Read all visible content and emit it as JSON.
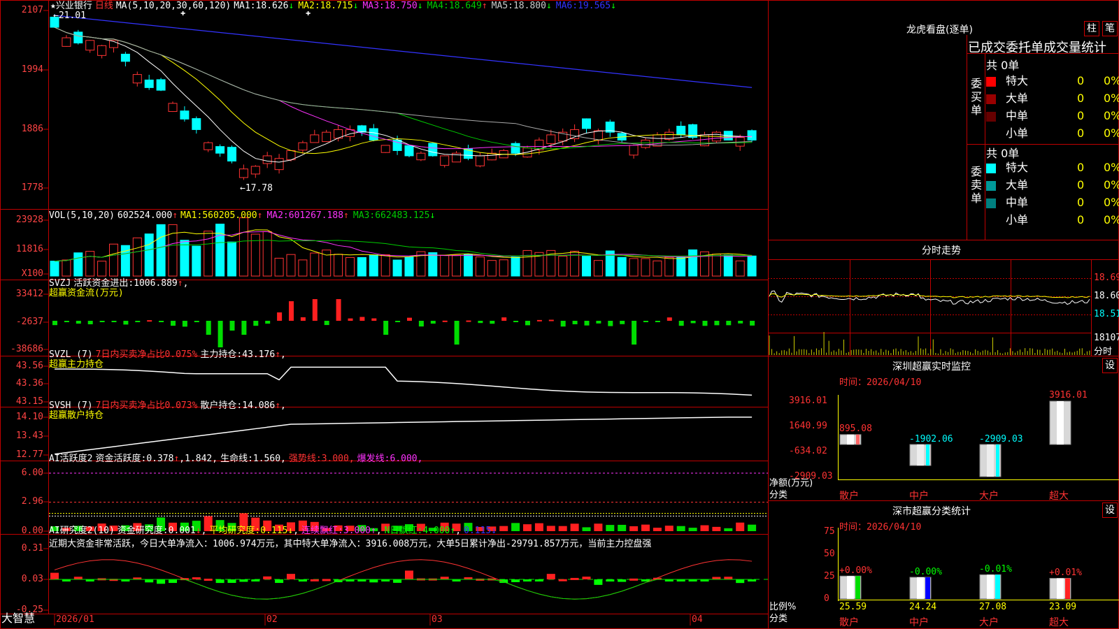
{
  "colors": {
    "up": "#ff3333",
    "down": "#00ffff",
    "grid": "#c00000",
    "ma1": "#ffffff",
    "ma2": "#ffff00",
    "ma3": "#ff33ff",
    "ma4": "#00cc00",
    "ma5": "#aaaaaa",
    "ma6": "#3333ff"
  },
  "stock": {
    "name": "兴业银行",
    "period": "日线",
    "star": "★"
  },
  "main_header": {
    "ma_def": "MA(5,10,20,30,60,120)",
    "ma": [
      {
        "label": "MA1:",
        "value": "18.626",
        "arrow": "↓",
        "color": "#ffffff"
      },
      {
        "label": "MA2:",
        "value": "18.715",
        "arrow": "↓",
        "color": "#ffff00"
      },
      {
        "label": "MA3:",
        "value": "18.750",
        "arrow": "↓",
        "color": "#ff33ff"
      },
      {
        "label": "MA4:",
        "value": "18.649",
        "arrow": "↑",
        "color": "#00cc00"
      },
      {
        "label": "MA5:",
        "value": "18.800",
        "arrow": "↓",
        "color": "#cccccc"
      },
      {
        "label": "MA6:",
        "value": "19.565",
        "arrow": "↓",
        "color": "#3333ff"
      }
    ],
    "high_note": "←21.01",
    "low_note": "←17.78"
  },
  "y_labels": {
    "price": [
      "2107",
      "1994",
      "1886",
      "1778"
    ],
    "vol": [
      "23928",
      "11816",
      "X100"
    ],
    "svzj": [
      "33412",
      "-2637",
      "-38686"
    ],
    "svzl": [
      "43.56",
      "43.36",
      "43.15"
    ],
    "svsh": [
      "14.10",
      "13.43",
      "12.77"
    ],
    "ai1": [
      "6.00",
      "2.96",
      "0.00"
    ],
    "ai2": [
      "0.31",
      "0.03",
      "-0.25"
    ]
  },
  "vol_header": {
    "name": "VOL(5,10,20)",
    "value": "602524.000",
    "arrow": "↑",
    "ma": [
      {
        "label": "MA1:",
        "value": "560205.000",
        "arrow": "↑",
        "color": "#ffff00"
      },
      {
        "label": "MA2:",
        "value": "601267.188",
        "arrow": "↑",
        "color": "#ff33ff"
      },
      {
        "label": "MA3:",
        "value": "662483.125",
        "arrow": "↓",
        "color": "#00cc00"
      }
    ]
  },
  "svzj_header": {
    "name": "SVZJ",
    "item": "活跃资金进出:",
    "value": "1006.889",
    "arrow": "↑",
    "sub": "超赢资金流(万元)"
  },
  "svzl_header": {
    "name": "SVZL (7)",
    "item1": "7日内买卖净占比0.075%",
    "item2": "主力持仓:",
    "value": "43.176",
    "arrow": "↑",
    "sub": "超赢主力持仓"
  },
  "svsh_header": {
    "name": "SVSH (7)",
    "item1": "7日内买卖净占比0.073%",
    "item2": "散户持仓:",
    "value": "14.086",
    "arrow": "↑",
    "sub": "超赢散户持仓"
  },
  "ai1_header": {
    "name": "AI活跃度2",
    "a_label": "资金活跃度:",
    "a_value": "0.378",
    "a_arrow": "↑",
    "b_value": "1.842",
    "c_label": "生命线:",
    "c_value": "1.560",
    "d_label": "强势线:",
    "d_value": "3.000",
    "e_label": "爆发线:",
    "e_value": "6.000"
  },
  "ai2_header": {
    "name": "AI研究度2(10)",
    "a_label": "资金研究度:",
    "a_value": "0.001",
    "a_arrow": "↓",
    "b_label": "平均研究度:",
    "b_value": "0.115",
    "b_arrow": "↓",
    "c_label": "连续飘红:",
    "c_value": "3.000",
    "c_arrow": "↑",
    "d_label": "N日飘红:",
    "d_value": "4.000",
    "d_arrow": "↑",
    "e_value": "0.115",
    "e_arrow": "↓",
    "note": "近期大资金非常活跃，今日大单净流入：1006.974万元，其中特大单净流入：3916.008万元，大单5日累计净出-29791.857万元，当前主力控盘强"
  },
  "x_axis": {
    "brand": "大智慧",
    "labels": [
      "2026/01",
      "02",
      "03",
      "04"
    ]
  },
  "dragon": {
    "title": "龙虎看盘(逐单)",
    "btn_a": "柱",
    "btn_b": "笔",
    "heading": "已成交委托单成交量统计",
    "buy": {
      "side": "委买单",
      "total": "共 0单",
      "rows": [
        {
          "label": "特大",
          "count": "0",
          "pct": "0%",
          "color": "#ff0000"
        },
        {
          "label": "大单",
          "count": "0",
          "pct": "0%",
          "color": "#990000"
        },
        {
          "label": "中单",
          "count": "0",
          "pct": "0%",
          "color": "#660000"
        },
        {
          "label": "小单",
          "count": "0",
          "pct": "0%",
          "color": ""
        }
      ]
    },
    "sell": {
      "side": "委卖单",
      "total": "共 0单",
      "rows": [
        {
          "label": "特大",
          "count": "0",
          "pct": "0%",
          "color": "#00ffff"
        },
        {
          "label": "大单",
          "count": "0",
          "pct": "0%",
          "color": "#009999"
        },
        {
          "label": "中单",
          "count": "0",
          "pct": "0%",
          "color": "#008080"
        },
        {
          "label": "小单",
          "count": "0",
          "pct": "0%",
          "color": ""
        }
      ]
    }
  },
  "intraday": {
    "title": "分时走势",
    "prices": [
      "18.69",
      "18.60",
      "18.51"
    ],
    "vol": "18107",
    "unit": "分时"
  },
  "monitor": {
    "title": "深圳超赢实时监控",
    "btn": "设",
    "date": "时间：2026/04/10",
    "y_labels": [
      "3916.01",
      "1640.99",
      "-634.02",
      "-2909.03"
    ],
    "ylabel": "净额(万元)",
    "xlabel": "分类",
    "bars": [
      {
        "cat": "散户",
        "value": 895.08,
        "label": "895.08"
      },
      {
        "cat": "中户",
        "value": -1902.06,
        "label": "-1902.06"
      },
      {
        "cat": "大户",
        "value": -2909.03,
        "label": "-2909.03"
      },
      {
        "cat": "超大",
        "value": 3916.01,
        "label": "3916.01"
      }
    ]
  },
  "classify": {
    "title": "深市超赢分类统计",
    "btn": "设",
    "date": "时间：2026/04/10",
    "y_labels": [
      "75",
      "50",
      "25",
      "0"
    ],
    "ylabel": "比例%",
    "xlabel": "分类",
    "bars": [
      {
        "cat": "散户",
        "value": 25.59,
        "change": "+0.00%",
        "color": "#00dd00"
      },
      {
        "cat": "中户",
        "value": 24.24,
        "change": "-0.00%",
        "color": "#0000ff"
      },
      {
        "cat": "大户",
        "value": 27.08,
        "change": "-0.01%",
        "color": "#00ffff"
      },
      {
        "cat": "超大",
        "value": 23.09,
        "change": "+0.01%",
        "color": "#ff2222"
      }
    ]
  }
}
